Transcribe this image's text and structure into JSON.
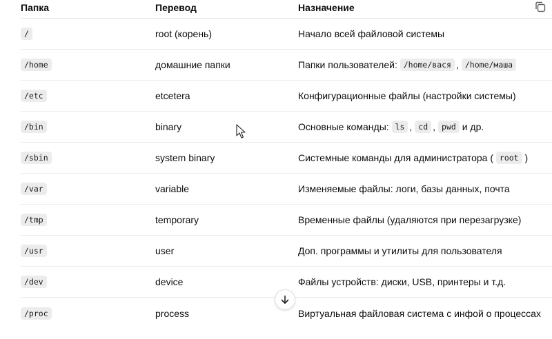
{
  "header": {
    "col1": "Папка",
    "col2": "Перевод",
    "col3": "Назначение"
  },
  "rows": [
    {
      "folder": "/",
      "translation": "root (корень)",
      "desc": "Начало всей файловой системы"
    },
    {
      "folder": "/home",
      "translation": "домашние папки",
      "desc_prefix": "Папки пользователей:",
      "codes": [
        "/home/вася",
        "/home/маша"
      ]
    },
    {
      "folder": "/etc",
      "translation": "etcetera",
      "desc": "Конфигурационные файлы (настройки системы)"
    },
    {
      "folder": "/bin",
      "translation": "binary",
      "desc_prefix": "Основные команды:",
      "codes": [
        "ls",
        "cd",
        "pwd"
      ],
      "desc_suffix": "и др."
    },
    {
      "folder": "/sbin",
      "translation": "system binary",
      "desc_prefix": "Системные команды для администратора (",
      "codes": [
        "root"
      ],
      "desc_suffix": ")"
    },
    {
      "folder": "/var",
      "translation": "variable",
      "desc": "Изменяемые файлы: логи, базы данных, почта"
    },
    {
      "folder": "/tmp",
      "translation": "temporary",
      "desc": "Временные файлы (удаляются при перезагрузке)"
    },
    {
      "folder": "/usr",
      "translation": "user",
      "desc": "Доп. программы и утилиты для пользователя"
    },
    {
      "folder": "/dev",
      "translation": "device",
      "desc": "Файлы устройств: диски, USB, принтеры и т.д."
    },
    {
      "folder": "/proc",
      "translation": "process",
      "desc": "Виртуальная файловая система с инфой о процессах"
    }
  ],
  "punct": {
    "comma": ","
  },
  "icons": {
    "copy": "copy-icon",
    "scroll": "arrow-down-icon",
    "cursor": "mouse-pointer-icon"
  }
}
